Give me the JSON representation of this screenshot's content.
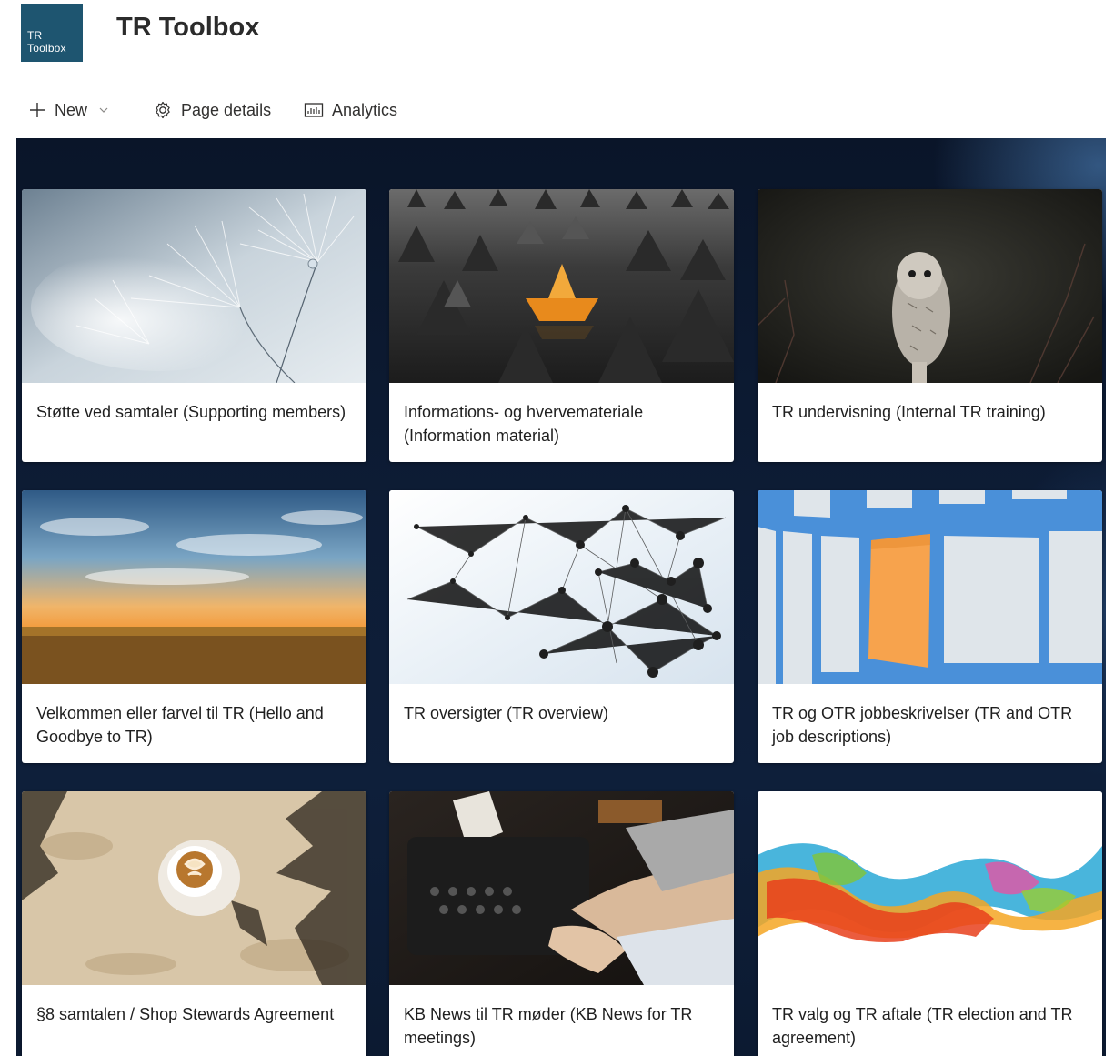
{
  "site": {
    "logo_line1": "TR",
    "logo_line2": "Toolbox",
    "title": "TR Toolbox",
    "logo_color": "#1e5570"
  },
  "commandbar": {
    "new_label": "New",
    "page_details_label": "Page details",
    "analytics_label": "Analytics"
  },
  "tiles": [
    {
      "title": "Støtte ved samtaler (Supporting members)",
      "image": "dandelion-seeds-photo"
    },
    {
      "title": "Informations- og hvervemateriale (Information material)",
      "image": "paper-boats-photo"
    },
    {
      "title": "TR undervisning (Internal TR training)",
      "image": "owl-photo"
    },
    {
      "title": "Velkommen eller farvel til TR (Hello and Goodbye to TR)",
      "image": "sunset-field-photo"
    },
    {
      "title": "TR oversigter (TR overview)",
      "image": "network-nodes-photo"
    },
    {
      "title": "TR og OTR jobbeskrivelser (TR and OTR job descriptions)",
      "image": "sticky-notes-photo"
    },
    {
      "title": "§8 samtalen / Shop Stewards Agreement",
      "image": "coffee-cup-photo"
    },
    {
      "title": "KB News til TR møder (KB News for TR meetings)",
      "image": "typewriter-photo"
    },
    {
      "title": "TR valg og TR aftale (TR election and TR agreement)",
      "image": "colored-smoke-photo"
    }
  ]
}
